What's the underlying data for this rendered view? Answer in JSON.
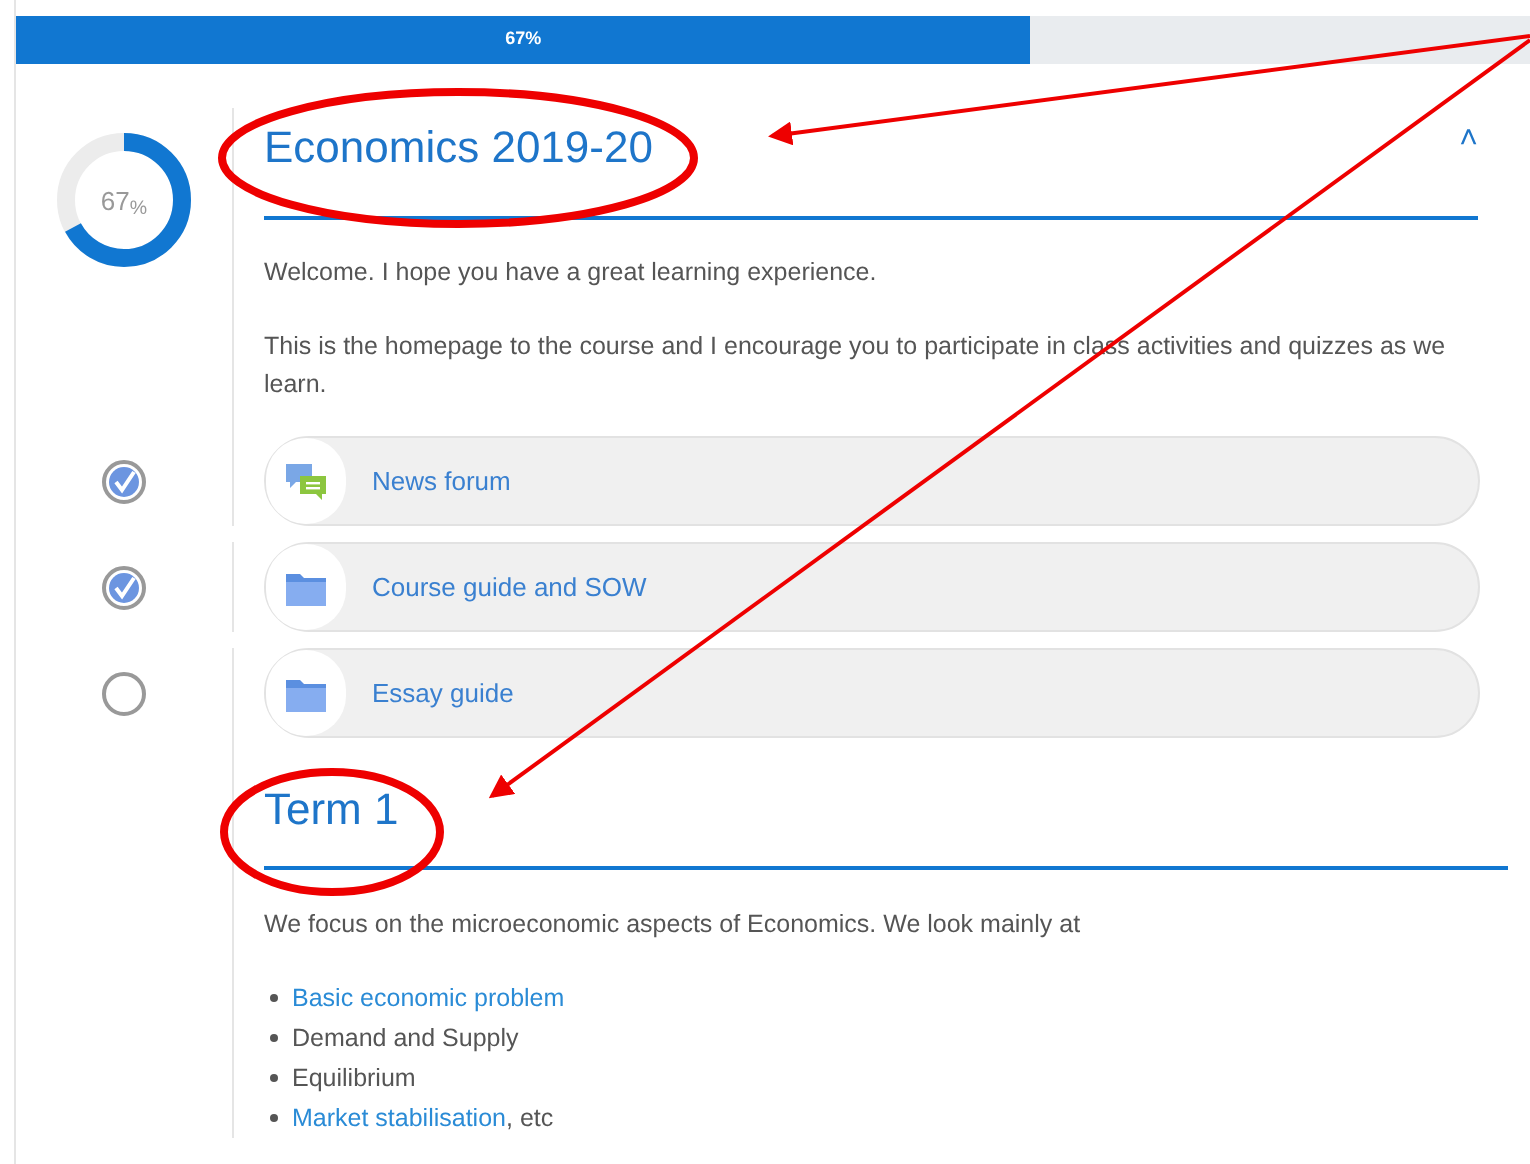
{
  "progress_bar": {
    "label": "67%",
    "level": 0.67
  },
  "progress_donut": {
    "label": "67$_{%}$",
    "level": 0.67
  },
  "section": {
    "title": "Economics 2019-20",
    "collapse_icon": "˄",
    "paragraphs": [
      "Welcome. I hope you have a great learning experience.",
      "This is the homepage to the course and I encourage you to participate in class activities and quizzes as we learn."
    ]
  },
  "activities": [
    {
      "kind": "forum",
      "label": "News forum",
      "checked": true
    },
    {
      "kind": "folder",
      "label": "Course guide and SOW",
      "checked": true
    },
    {
      "kind": "folder",
      "label": "Essay guide",
      "checked": false
    }
  ],
  "term_section": {
    "title": "Term 1",
    "intro": "We focus on the microeconomic aspects of Economics. We look mainly at",
    "bullets": [
      {
        "parts": [
          {
            "text": "Basic economic problem",
            "link": true
          }
        ]
      },
      {
        "parts": [
          {
            "text": "Demand and Supply",
            "link": false
          }
        ]
      },
      {
        "parts": [
          {
            "text": "Equilibrium",
            "link": false
          }
        ]
      },
      {
        "parts": [
          {
            "text": "Market stabilisation",
            "link": true
          },
          {
            "text": ", etc",
            "link": false
          }
        ]
      }
    ]
  }
}
